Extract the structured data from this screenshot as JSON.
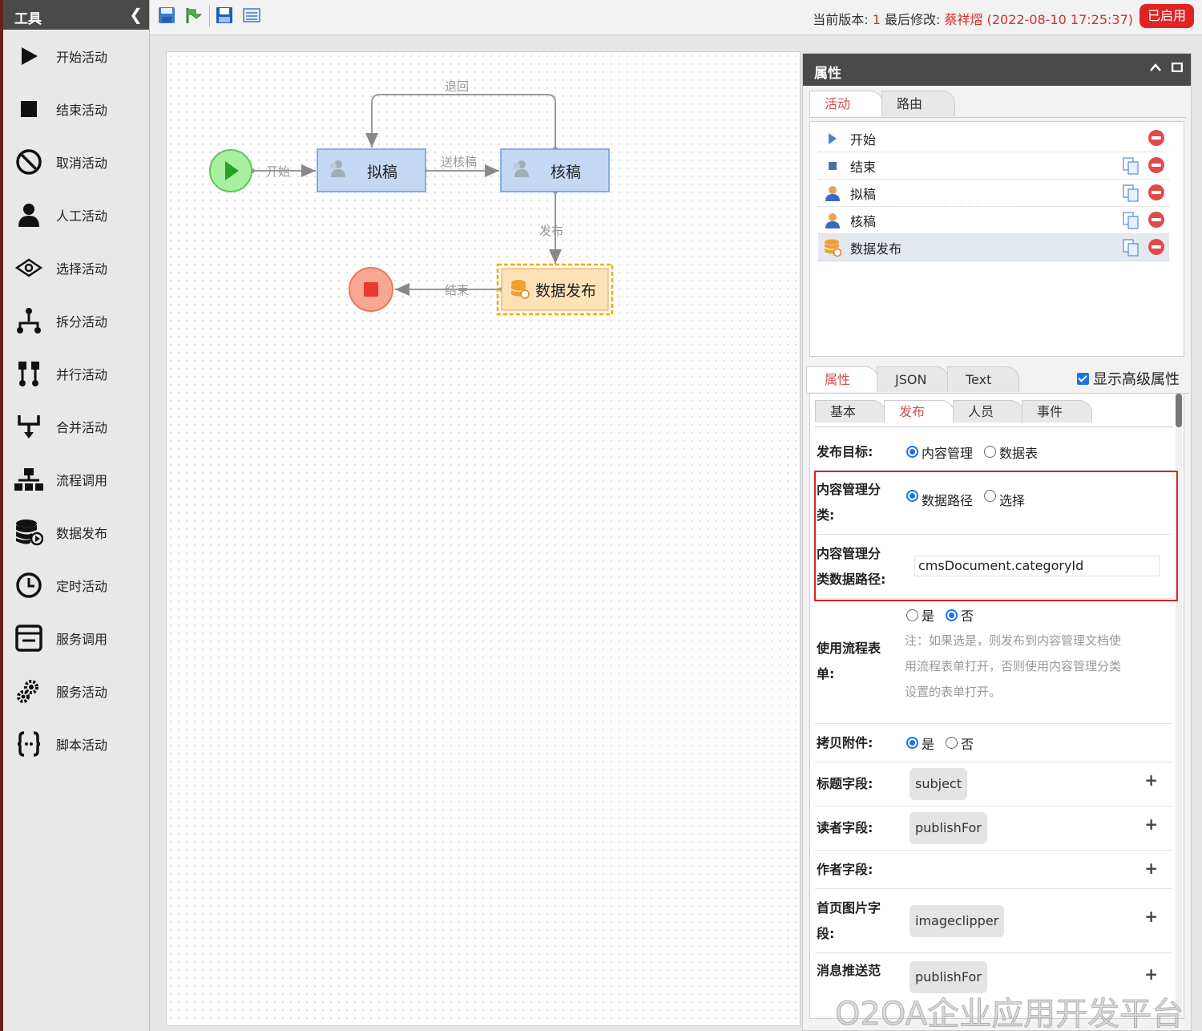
{
  "tools": {
    "title": "工具",
    "items": [
      {
        "label": "开始活动",
        "icon": "play-icon"
      },
      {
        "label": "结束活动",
        "icon": "stop-icon"
      },
      {
        "label": "取消活动",
        "icon": "cancel-icon"
      },
      {
        "label": "人工活动",
        "icon": "person-icon"
      },
      {
        "label": "选择活动",
        "icon": "choice-icon"
      },
      {
        "label": "拆分活动",
        "icon": "split-icon"
      },
      {
        "label": "并行活动",
        "icon": "parallel-icon"
      },
      {
        "label": "合并活动",
        "icon": "merge-icon"
      },
      {
        "label": "流程调用",
        "icon": "org-chart-icon"
      },
      {
        "label": "数据发布",
        "icon": "database-icon"
      },
      {
        "label": "定时活动",
        "icon": "clock-icon"
      },
      {
        "label": "服务调用",
        "icon": "service-window-icon"
      },
      {
        "label": "服务活动",
        "icon": "gears-icon"
      },
      {
        "label": "脚本活动",
        "icon": "braces-icon"
      }
    ]
  },
  "toolbar": {
    "version_label": "当前版本: ",
    "version": "1",
    "modified_label": " 最后修改: ",
    "modifier": "蔡祥熠",
    "modified_time": " (2022-08-10 17:25:37)",
    "status": "已启用"
  },
  "flow": {
    "nodes": {
      "draft": "拟稿",
      "review": "核稿",
      "publish": "数据发布"
    },
    "edges": {
      "start": "开始",
      "send_review": "送核稿",
      "back": "退回",
      "publish": "发布",
      "end": "结束"
    }
  },
  "props": {
    "title": "属性",
    "list_tabs": [
      "活动",
      "路由"
    ],
    "activities": [
      {
        "name": "开始",
        "icon": "play-icon"
      },
      {
        "name": "结束",
        "icon": "stop-icon"
      },
      {
        "name": "拟稿",
        "icon": "person-icon"
      },
      {
        "name": "核稿",
        "icon": "person-icon"
      },
      {
        "name": "数据发布",
        "icon": "database-icon"
      }
    ],
    "detail_tabs": [
      "属性",
      "JSON",
      "Text"
    ],
    "advanced_label": "显示高级属性",
    "sub_tabs": [
      "基本",
      "发布",
      "人员",
      "事件"
    ],
    "form": {
      "target_label": "发布目标:",
      "target_opt1": "内容管理",
      "target_opt2": "数据表",
      "category_label_1": "内容管理分",
      "category_label_2": "类:",
      "category_opt1": "数据路径",
      "category_opt2": "选择",
      "path_label_1": "内容管理分",
      "path_label_2": "类数据路径:",
      "path_value": "cmsDocument.categoryId",
      "useform_label_1": "使用流程表",
      "useform_label_2": "单:",
      "useform_yes": "是",
      "useform_no": "否",
      "useform_note_1": "注：如果选是，则发布到内容管理文档使",
      "useform_note_2": "用流程表单打开，否则使用内容管理分类",
      "useform_note_3": "设置的表单打开。",
      "attach_label": "拷贝附件:",
      "attach_yes": "是",
      "attach_no": "否",
      "title_label": "标题字段:",
      "title_value": "subject",
      "reader_label": "读者字段:",
      "reader_value": "publishFor",
      "author_label": "作者字段:",
      "image_label_1": "首页图片字",
      "image_label_2": "段:",
      "image_value": "imageclipper",
      "push_label_1": "消息推送范",
      "push_value": "publishFor"
    }
  },
  "watermark": "O2OA企业应用开发平台"
}
